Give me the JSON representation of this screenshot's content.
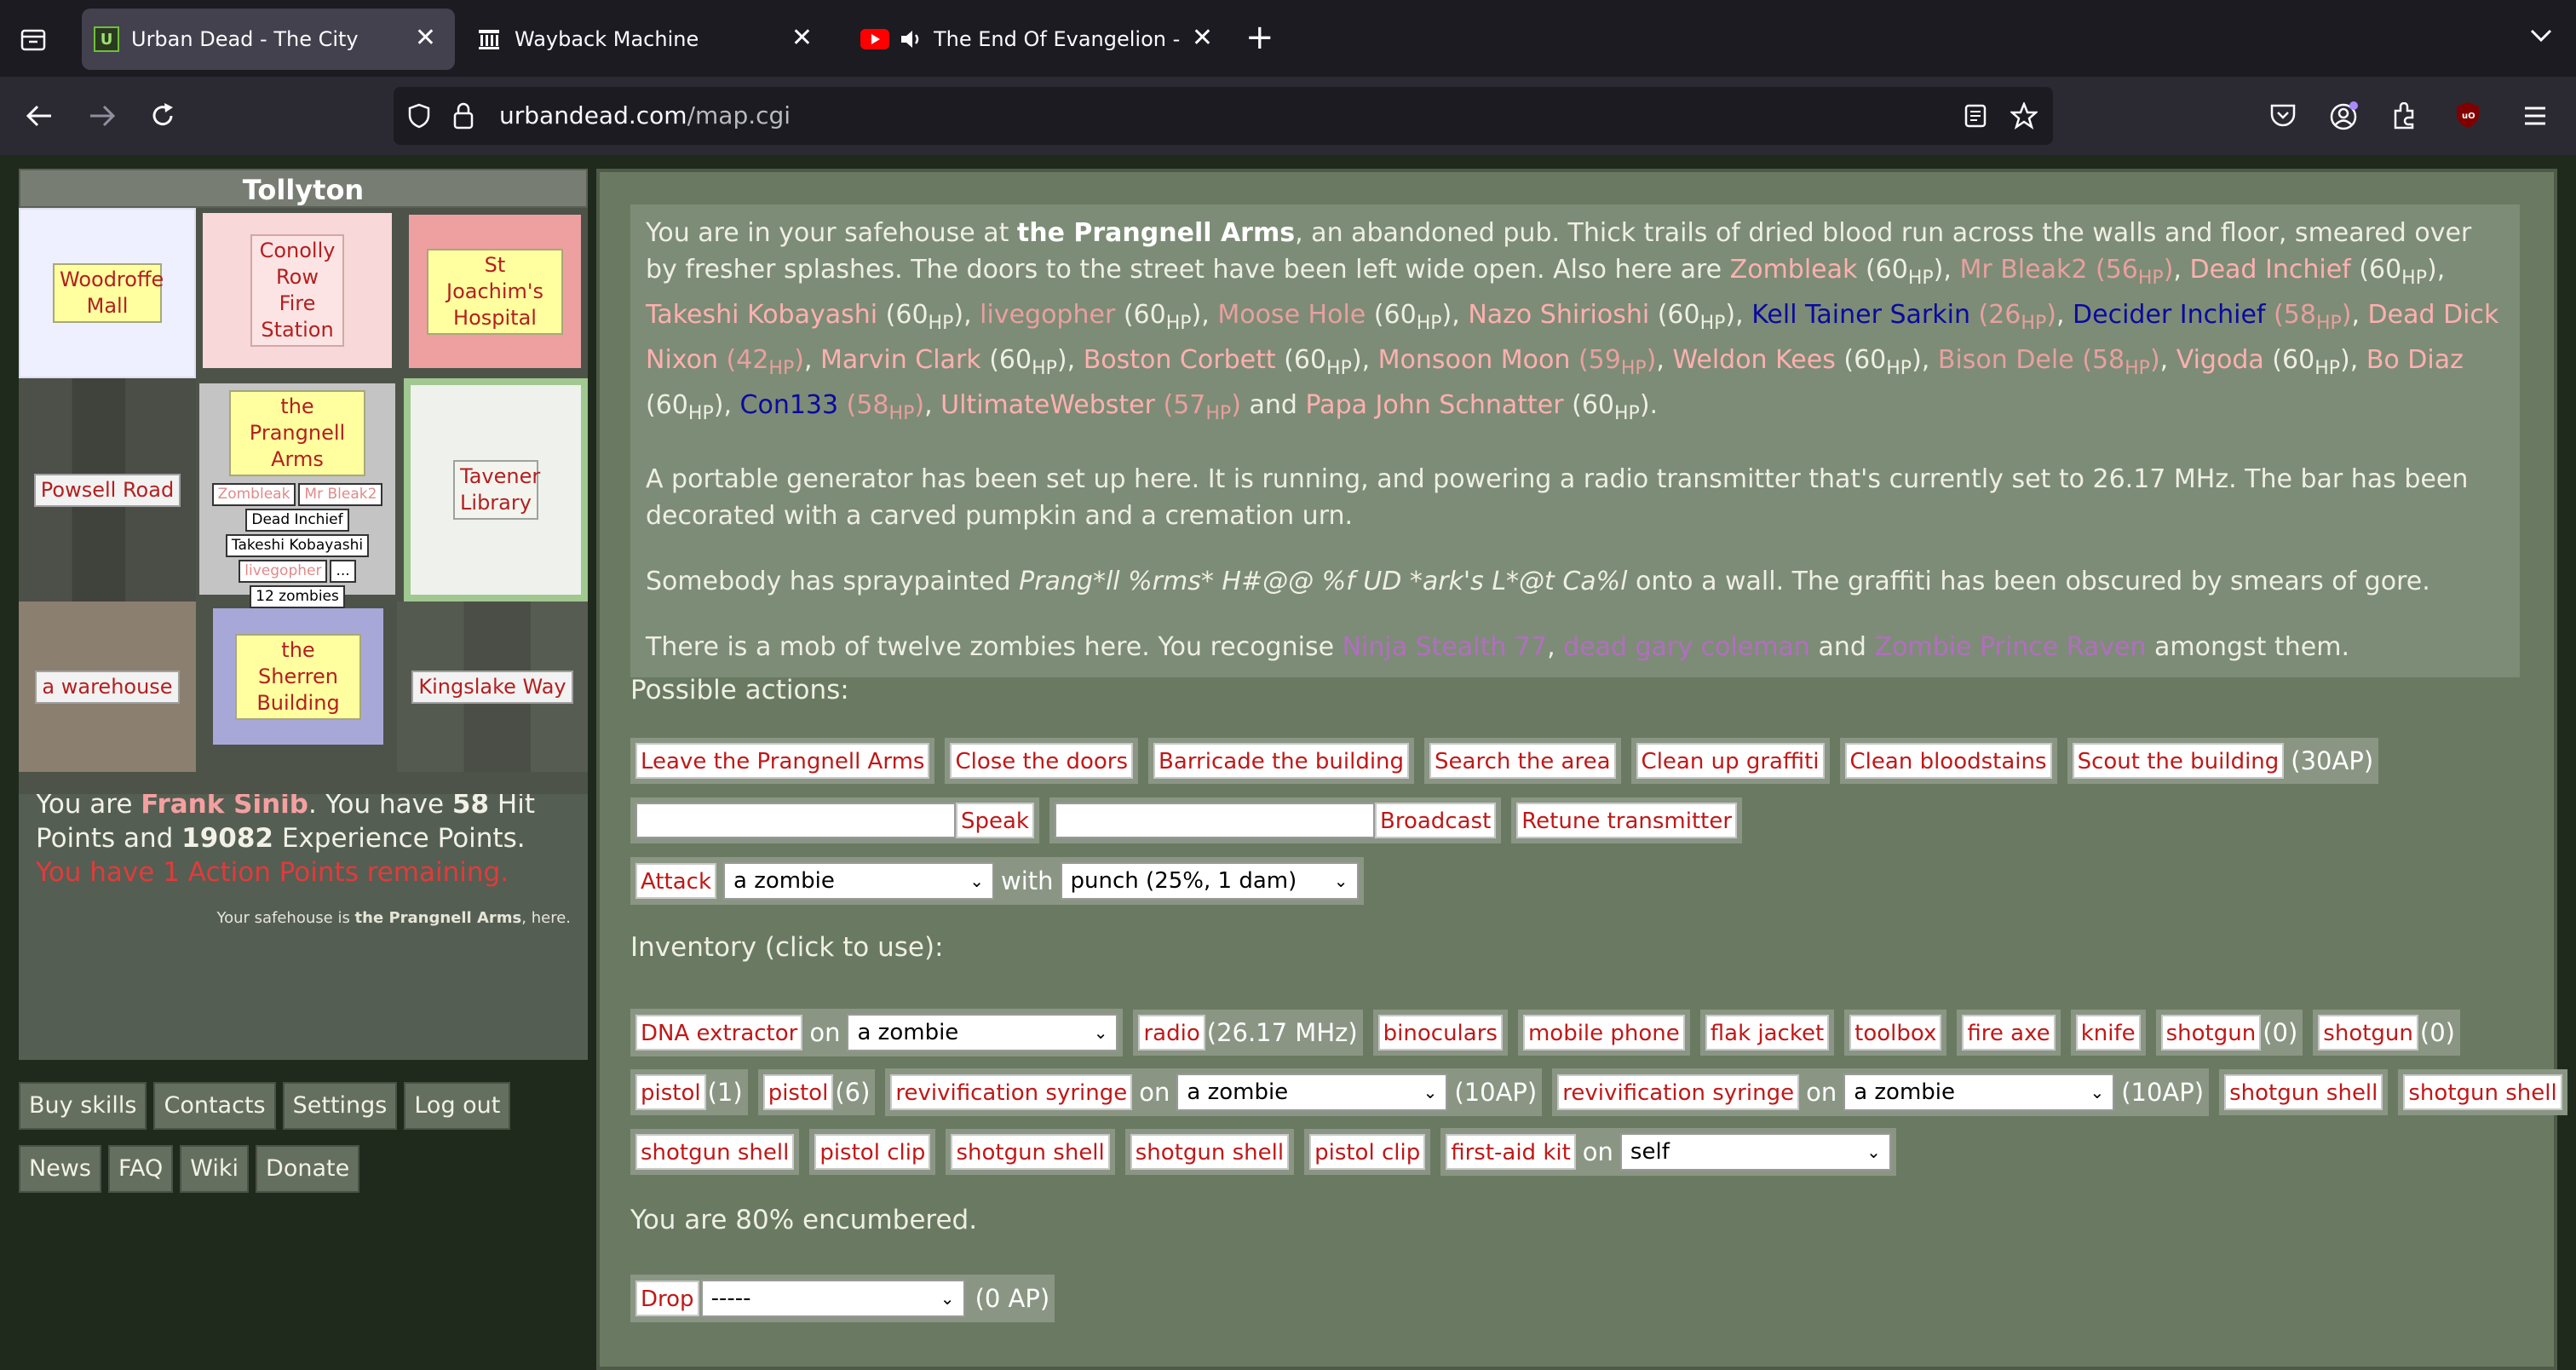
{
  "browser": {
    "tabs": [
      {
        "title": "Urban Dead - The City",
        "icon": "ud-favicon"
      },
      {
        "title": "Wayback Machine",
        "icon": "wayback-favicon"
      },
      {
        "title": "The End Of Evangelion - Ko",
        "icon": "youtube-favicon"
      }
    ],
    "url_host": "urbandead.com",
    "url_path": "/map.cgi"
  },
  "map": {
    "title": "Tollyton",
    "cells": {
      "woodroffe": "Woodroffe Mall",
      "conolly": "Conolly Row Fire Station",
      "stjoachim": "St Joachim's Hospital",
      "powsell": "Powsell Road",
      "prangnell": "the Prangnell Arms",
      "tavener": "Tavener Library",
      "warehouse": "a warehouse",
      "sherren": "the Sherren Building",
      "kingslake": "Kingslake Way"
    },
    "occupants": [
      "Zombleak",
      "Mr Bleak2",
      "Dead Inchief",
      "Takeshi Kobayashi",
      "livegopher",
      "...",
      "12 zombies"
    ]
  },
  "status": {
    "you_are": "You are ",
    "name": "Frank Sinib",
    "have": ". You have ",
    "hp": "58",
    "hp_text": " Hit Points and ",
    "xp": "19082",
    "xp_text": " Experience Points. ",
    "ap_text": "You have 1 Action Points remaining.",
    "safehouse_pre": "Your safehouse is ",
    "safehouse_name": "the Prangnell Arms",
    "safehouse_post": ", here."
  },
  "links": {
    "row1": [
      "Buy skills",
      "Contacts",
      "Settings",
      "Log out"
    ],
    "row2": [
      "News",
      "FAQ",
      "Wiki",
      "Donate"
    ]
  },
  "description": {
    "p1_a": "You are in your safehouse at ",
    "p1_place": "the Prangnell Arms",
    "p1_b": ", an abandoned pub. Thick trails of dried blood run across the walls and floor, smeared over by fresher splashes. The doors to the street have been left wide open. Also here are ",
    "people": [
      {
        "name": "Zombleak",
        "hp": "60",
        "color": "pk",
        "hpcolor": "",
        "sep": ", "
      },
      {
        "name": "Mr Bleak2",
        "hp": "56",
        "color": "pk2",
        "hpcolor": "pk2",
        "sep": ", "
      },
      {
        "name": "Dead Inchief",
        "hp": "60",
        "color": "pk",
        "hpcolor": "",
        "sep": ", "
      },
      {
        "name": "Takeshi Kobayashi",
        "hp": "60",
        "color": "pk",
        "hpcolor": "",
        "sep": ", "
      },
      {
        "name": "livegopher",
        "hp": "60",
        "color": "pk2",
        "hpcolor": "",
        "sep": ", "
      },
      {
        "name": "Moose Hole",
        "hp": "60",
        "color": "pk2",
        "hpcolor": "",
        "sep": ", "
      },
      {
        "name": "Nazo Shirioshi",
        "hp": "60",
        "color": "pk",
        "hpcolor": "",
        "sep": ", "
      },
      {
        "name": "Kell Tainer Sarkin",
        "hp": "26",
        "color": "bl",
        "hpcolor": "pk2",
        "sep": ", "
      },
      {
        "name": "Decider Inchief",
        "hp": "58",
        "color": "bl",
        "hpcolor": "pk2",
        "sep": ", "
      },
      {
        "name": "Dead Dick Nixon",
        "hp": "42",
        "color": "pk",
        "hpcolor": "pk2",
        "sep": ", "
      },
      {
        "name": "Marvin Clark",
        "hp": "60",
        "color": "pk",
        "hpcolor": "",
        "sep": ", "
      },
      {
        "name": "Boston Corbett",
        "hp": "60",
        "color": "pk",
        "hpcolor": "",
        "sep": ", "
      },
      {
        "name": "Monsoon Moon",
        "hp": "59",
        "color": "pk",
        "hpcolor": "pk2",
        "sep": ", "
      },
      {
        "name": "Weldon Kees",
        "hp": "60",
        "color": "pk",
        "hpcolor": "",
        "sep": ", "
      },
      {
        "name": "Bison Dele",
        "hp": "58",
        "color": "pk2",
        "hpcolor": "pk2",
        "sep": ", "
      },
      {
        "name": "Vigoda",
        "hp": "60",
        "color": "pk",
        "hpcolor": "",
        "sep": ", "
      },
      {
        "name": "Bo Diaz",
        "hp": "60",
        "color": "pk",
        "hpcolor": "",
        "sep": ", "
      },
      {
        "name": "Con133",
        "hp": "58",
        "color": "bl",
        "hpcolor": "pk2",
        "sep": ", "
      },
      {
        "name": "UltimateWebster",
        "hp": "57",
        "color": "pk",
        "hpcolor": "pk2",
        "sep": " and "
      },
      {
        "name": "Papa John Schnatter",
        "hp": "60",
        "color": "pk",
        "hpcolor": "",
        "sep": "."
      }
    ],
    "hp_unit": "HP",
    "p2": "A portable generator has been set up here. It is running, and powering a radio transmitter that's currently set to 26.17 MHz. The bar has been decorated with a carved pumpkin and a cremation urn.",
    "p3_a": "Somebody has spraypainted ",
    "p3_graffiti": "Prang*ll %rms* H#@@ %f UD *ark's L*@t Ca%l",
    "p3_b": " onto a wall. The graffiti has been obscured by smears of gore.",
    "p4_a": "There is a mob of twelve zombies here. You recognise ",
    "z1": "Ninja Stealth 77",
    "z_sep": ", ",
    "z2": "dead gary coleman",
    "z_and": " and ",
    "z3": "Zombie Prince Raven",
    "p4_b": " amongst them."
  },
  "actions": {
    "heading": "Possible actions:",
    "buttons": [
      "Leave the Prangnell Arms",
      "Close the doors",
      "Barricade the building",
      "Search the area",
      "Clean up graffiti",
      "Clean bloodstains",
      "Scout the building"
    ],
    "scout_cost": "(30AP)",
    "speak": "Speak",
    "broadcast": "Broadcast",
    "retune": "Retune transmitter",
    "attack": "Attack",
    "attack_target": "a zombie",
    "with": "with",
    "weapon": "punch (25%, 1 dam)"
  },
  "inventory": {
    "heading": "Inventory (click to use):",
    "on": "on",
    "dna": "DNA extractor",
    "dna_target": "a zombie",
    "radio": "radio",
    "radio_freq": "(26.17 MHz)",
    "row1_items": [
      "binoculars",
      "mobile phone",
      "flak jacket",
      "toolbox",
      "fire axe",
      "knife"
    ],
    "shotgun": "shotgun",
    "shotgun1_count": "(0)",
    "shotgun2_count": "(0)",
    "pistol": "pistol",
    "pistol1_count": "(1)",
    "pistol2_count": "(6)",
    "syringe": "revivification syringe",
    "syringe_target": "a zombie",
    "syringe_cost": "(10AP)",
    "shotgun_shell": "shotgun shell",
    "pistol_clip": "pistol clip",
    "firstaid": "first-aid kit",
    "firstaid_target": "self",
    "encumbered": "You are 80% encumbered.",
    "drop": "Drop",
    "drop_sel": "-----",
    "drop_cost": "(0 AP)"
  }
}
